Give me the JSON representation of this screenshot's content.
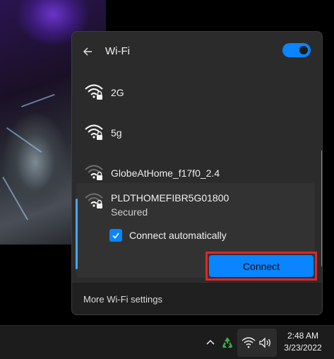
{
  "wifi_panel": {
    "title": "Wi-Fi",
    "toggle_on": true,
    "networks": [
      {
        "name": "2G",
        "secured": true,
        "signal": "full"
      },
      {
        "name": "5g",
        "secured": true,
        "signal": "full"
      },
      {
        "name": "GlobeAtHome_f17f0_2.4",
        "secured": true,
        "signal": "weak"
      }
    ],
    "expanded_network": {
      "name": "PLDTHOMEFIBR5G01800",
      "status": "Secured",
      "auto_connect_label": "Connect automatically",
      "auto_connect_checked": true,
      "connect_label": "Connect"
    },
    "footer_link": "More Wi-Fi settings"
  },
  "taskbar": {
    "time": "2:48 AM",
    "date": "3/23/2022",
    "tray_icons": [
      "chevron-up-icon",
      "recycle-app-icon",
      "wifi-icon",
      "volume-icon"
    ]
  },
  "colors": {
    "accent": "#0a84ff",
    "highlight_outline": "#e0262c",
    "panel_bg": "#2b2b2b"
  }
}
